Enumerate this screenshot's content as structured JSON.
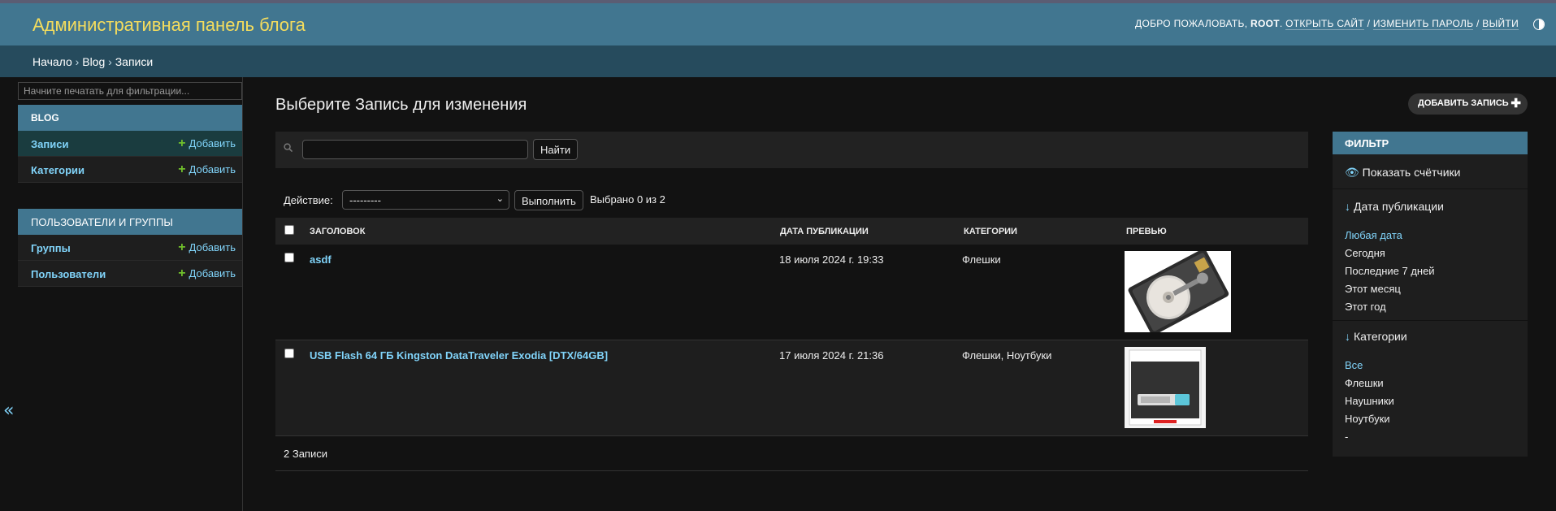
{
  "header": {
    "brand": "Административная панель блога",
    "welcome": "Добро пожаловать,",
    "username": "root",
    "view_site": "Открыть сайт",
    "change_password": "Изменить пароль",
    "logout": "Выйти"
  },
  "breadcrumbs": {
    "home": "Начало",
    "app": "Blog",
    "current": "Записи"
  },
  "sidebar": {
    "filter_placeholder": "Начните печатать для фильтрации...",
    "modules": [
      {
        "caption": "Blog",
        "items": [
          {
            "label": "Записи",
            "add": "Добавить"
          },
          {
            "label": "Категории",
            "add": "Добавить"
          }
        ]
      },
      {
        "caption": "Пользователи и группы",
        "items": [
          {
            "label": "Группы",
            "add": "Добавить"
          },
          {
            "label": "Пользователи",
            "add": "Добавить"
          }
        ]
      }
    ],
    "collapse_glyph": "«"
  },
  "content": {
    "title": "Выберите Запись для изменения",
    "add_button": "Добавить запись",
    "search_button": "Найти",
    "search_value": "",
    "action_label": "Действие:",
    "action_selected": "---------",
    "run_button": "Выполнить",
    "selected_counter": "Выбрано 0 из 2",
    "columns": [
      "Заголовок",
      "Дата публикации",
      "Категории",
      "Превью"
    ],
    "rows": [
      {
        "title": "asdf",
        "date": "18 июля 2024 г. 19:33",
        "categories": "Флешки",
        "preview": "hard-drive-image"
      },
      {
        "title": "USB Flash 64 ГБ Kingston DataTraveler Exodia [DTX/64GB]",
        "date": "17 июля 2024 г. 21:36",
        "categories": "Флешки, Ноутбуки",
        "preview": "usb-flash-package-image"
      }
    ],
    "paginator": "2 Записи"
  },
  "filter": {
    "caption": "Фильтр",
    "show_counts": "Показать счётчики",
    "date_title": "Дата публикации",
    "date_options": [
      "Любая дата",
      "Сегодня",
      "Последние 7 дней",
      "Этот месяц",
      "Этот год"
    ],
    "date_selected": "Любая дата",
    "cat_title": "Категории",
    "cat_options": [
      "Все",
      "Флешки",
      "Наушники",
      "Ноутбуки",
      "-"
    ],
    "cat_selected": "Все"
  },
  "colors": {
    "header_bg": "#417690",
    "brand": "#f5dd5d",
    "breadcrumbs_bg": "#264b5d",
    "link": "#81d4fa",
    "add_plus": "#70bf2b",
    "background": "#121212"
  },
  "icons": [
    "search-icon",
    "plus-icon",
    "eye-icon",
    "arrow-down-icon",
    "theme-toggle-icon",
    "collapse-icon",
    "chevron-down-icon"
  ]
}
